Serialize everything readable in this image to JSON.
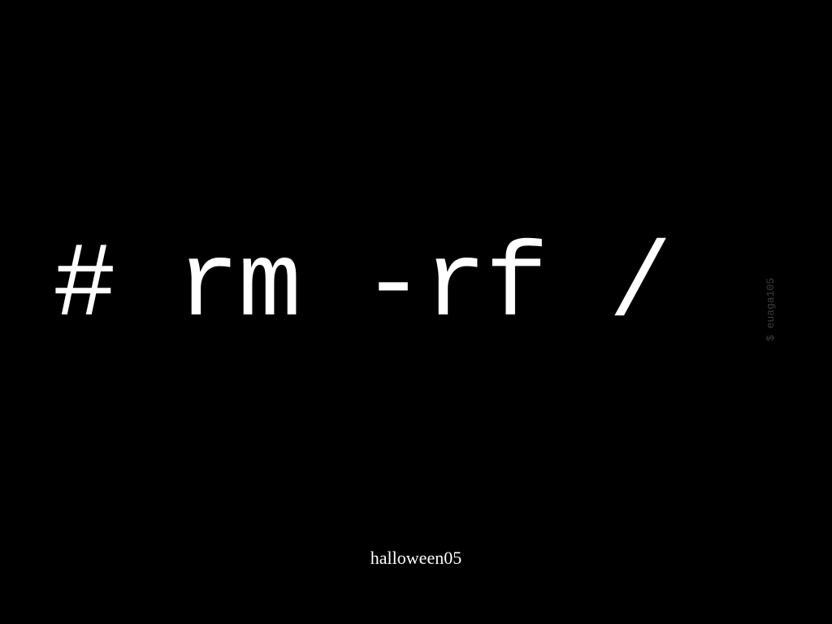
{
  "command": {
    "text": "# rm -rf /"
  },
  "side_label": {
    "text": "$ euaga105"
  },
  "caption": {
    "text": "halloween05"
  }
}
